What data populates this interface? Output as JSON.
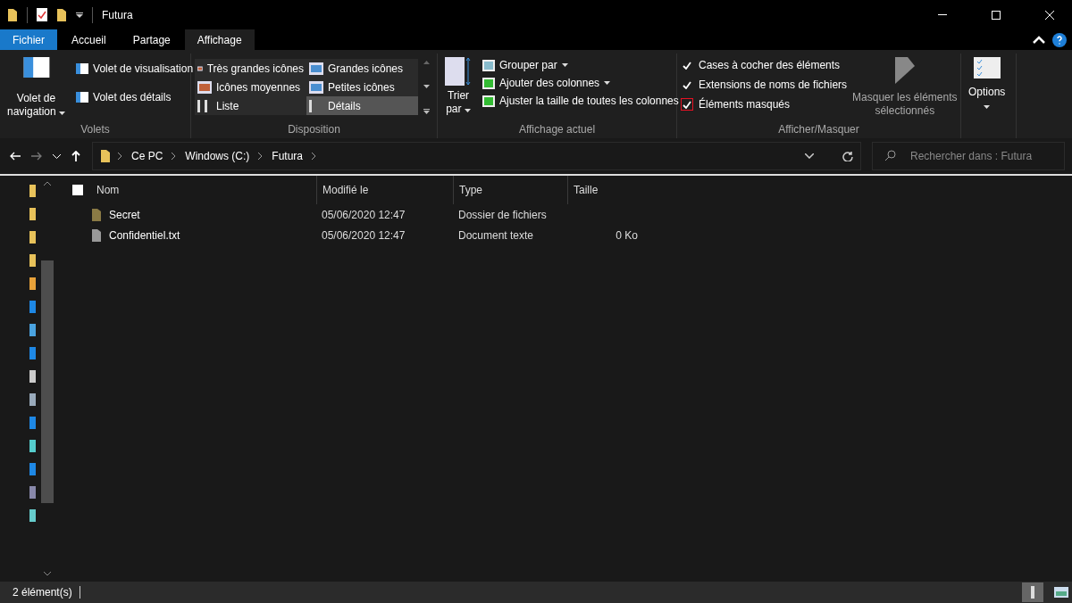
{
  "window": {
    "title": "Futura"
  },
  "ribbon_tabs": [
    {
      "label": "Fichier",
      "kind": "file",
      "selected": false
    },
    {
      "label": "Accueil",
      "kind": "tab",
      "selected": false
    },
    {
      "label": "Partage",
      "kind": "tab",
      "selected": false
    },
    {
      "label": "Affichage",
      "kind": "tab",
      "selected": true
    }
  ],
  "panes_group": {
    "label": "Volets",
    "navigation_pane": [
      "Volet de",
      "navigation"
    ],
    "items": [
      "Volet de visualisation",
      "Volet des détails"
    ]
  },
  "layout_group": {
    "label": "Disposition",
    "options": [
      {
        "label": "Très grandes icônes",
        "selected": false
      },
      {
        "label": "Grandes icônes",
        "selected": false
      },
      {
        "label": "Icônes moyennes",
        "selected": false
      },
      {
        "label": "Petites icônes",
        "selected": false
      },
      {
        "label": "Liste",
        "selected": false
      },
      {
        "label": "Détails",
        "selected": true
      }
    ]
  },
  "current_view_group": {
    "label": "Affichage actuel",
    "sort": [
      "Trier",
      "par"
    ],
    "items": [
      {
        "label": "Grouper par",
        "dropdown": true
      },
      {
        "label": "Ajouter des colonnes",
        "dropdown": true
      },
      {
        "label": "Ajuster la taille de toutes les colonnes",
        "dropdown": false
      }
    ]
  },
  "show_hide_group": {
    "label": "Afficher/Masquer",
    "checkboxes": [
      {
        "label": "Cases à cocher des éléments",
        "checked": true,
        "focused": false
      },
      {
        "label": "Extensions de noms de fichiers",
        "checked": true,
        "focused": false
      },
      {
        "label": "Éléments masqués",
        "checked": true,
        "focused": true
      }
    ],
    "hide_selected": [
      "Masquer les éléments",
      "sélectionnés"
    ]
  },
  "options_button": "Options",
  "address": {
    "crumbs": [
      "Ce PC",
      "Windows (C:)",
      "Futura"
    ]
  },
  "search": {
    "placeholder": "Rechercher dans : Futura"
  },
  "table": {
    "select_all": {
      "checked": false
    },
    "columns": [
      "Nom",
      "Modifié le",
      "Type",
      "Taille"
    ],
    "rows": [
      {
        "kind": "folder",
        "name": "Secret",
        "modified": "05/06/2020 12:47",
        "type": "Dossier de fichiers"
      },
      {
        "kind": "file",
        "name": "Confidentiel.txt",
        "modified": "05/06/2020 12:47",
        "type": "Document texte",
        "size": "0 Ko"
      }
    ]
  },
  "status_bar": {
    "count": "2 élément(s)",
    "views": [
      {
        "kind": "details",
        "selected": true
      },
      {
        "kind": "large",
        "selected": false
      }
    ]
  }
}
